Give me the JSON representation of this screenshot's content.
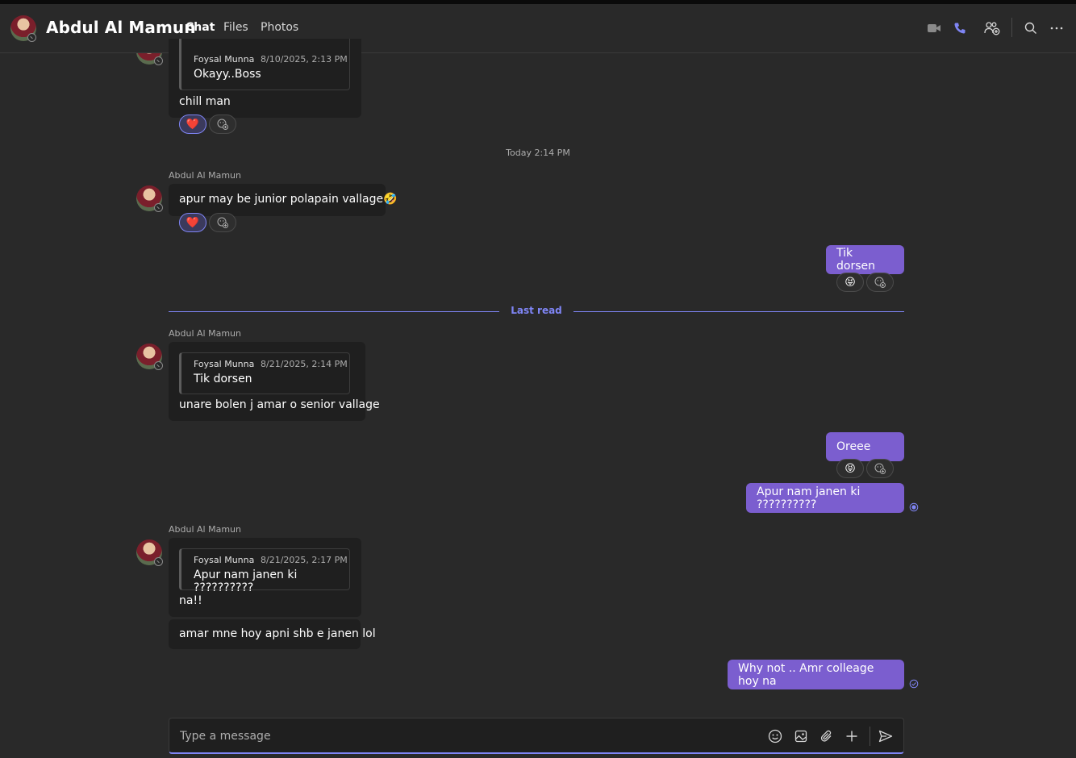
{
  "header": {
    "title": "Abdul Al Mamun",
    "tabs": [
      {
        "label": "Chat",
        "active": true
      },
      {
        "label": "Files",
        "active": false
      },
      {
        "label": "Photos",
        "active": false
      }
    ],
    "actions": [
      "video-call-icon",
      "audio-call-icon",
      "add-people-icon",
      "search-icon",
      "more-options-icon"
    ]
  },
  "messages": {
    "m1": {
      "quote": {
        "name": "Foysal Munna",
        "time": "8/10/2025, 2:13 PM",
        "text": "Okayy..Boss"
      },
      "text": "chill man",
      "reaction": "❤️"
    },
    "time_divider": "Today 2:14 PM",
    "m2": {
      "sender": "Abdul Al Mamun",
      "text": "apur may be junior polapain vallage🤣",
      "reaction": "❤️"
    },
    "m3": {
      "text": "Tik dorsen",
      "reaction": "😝"
    },
    "last_read": "Last read",
    "m4": {
      "sender": "Abdul Al Mamun",
      "quote": {
        "name": "Foysal Munna",
        "time": "8/21/2025, 2:14 PM",
        "text": "Tik dorsen"
      },
      "text": "unare bolen j amar o senior vallage"
    },
    "m5": {
      "text": "Oreee",
      "reaction": "😝"
    },
    "m6": {
      "text": "Apur nam janen ki ??????????"
    },
    "m7": {
      "sender": "Abdul Al Mamun",
      "quote": {
        "name": "Foysal Munna",
        "time": "8/21/2025, 2:17 PM",
        "text": "Apur nam janen ki ??????????"
      },
      "text": "na!!"
    },
    "m8": {
      "text": "amar mne hoy apni shb e janen lol"
    },
    "m9": {
      "text": "Why not .. Amr colleage hoy na"
    }
  },
  "composer": {
    "placeholder": "Type a message",
    "icons": [
      "emoji-icon",
      "image-icon",
      "attach-icon",
      "plus-icon",
      "send-icon"
    ]
  },
  "colors": {
    "accent": "#7f85f5",
    "outgoing_bubble": "#7b5ecf",
    "incoming_bubble": "#1f1f1f",
    "background": "#292929"
  }
}
